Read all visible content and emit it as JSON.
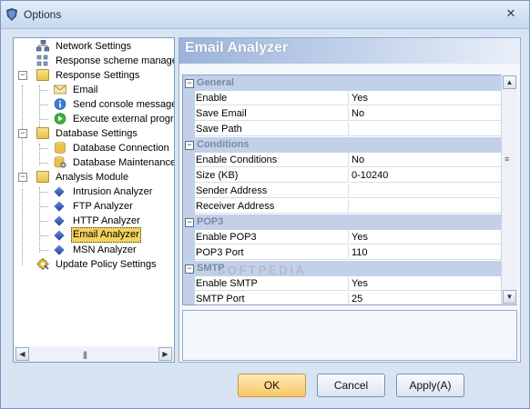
{
  "window": {
    "title": "Options",
    "close_glyph": "✕"
  },
  "tree": {
    "items": [
      {
        "label": "Network Settings",
        "icon": "network-icon"
      },
      {
        "label": "Response scheme management",
        "icon": "scheme-icon"
      },
      {
        "label": "Response Settings",
        "icon": "folder-icon"
      },
      {
        "label": "Email",
        "icon": "email-icon"
      },
      {
        "label": "Send console message",
        "icon": "info-icon"
      },
      {
        "label": "Execute external program",
        "icon": "play-icon"
      },
      {
        "label": "Database Settings",
        "icon": "folder-icon"
      },
      {
        "label": "Database Connection",
        "icon": "database-icon"
      },
      {
        "label": "Database Maintenance",
        "icon": "database-gear-icon"
      },
      {
        "label": "Analysis Module",
        "icon": "folder-icon"
      },
      {
        "label": "Intrusion Analyzer",
        "icon": "module-icon"
      },
      {
        "label": "FTP Analyzer",
        "icon": "module-icon"
      },
      {
        "label": "HTTP Analyzer",
        "icon": "module-icon"
      },
      {
        "label": "Email Analyzer",
        "icon": "module-icon",
        "selected": true
      },
      {
        "label": "MSN Analyzer",
        "icon": "module-icon"
      },
      {
        "label": "Update Policy Settings",
        "icon": "update-gear-icon"
      }
    ],
    "scroll_grip": "|||"
  },
  "panel": {
    "title": "Email Analyzer"
  },
  "grid": {
    "categories": [
      {
        "name": "General",
        "rows": [
          {
            "name": "Enable",
            "value": "Yes"
          },
          {
            "name": "Save Email",
            "value": "No"
          },
          {
            "name": "Save Path",
            "value": ""
          }
        ]
      },
      {
        "name": "Conditions",
        "rows": [
          {
            "name": "Enable Conditions",
            "value": "No"
          },
          {
            "name": "Size (KB)",
            "value": "0-10240"
          },
          {
            "name": "Sender Address",
            "value": ""
          },
          {
            "name": "Receiver Address",
            "value": ""
          }
        ]
      },
      {
        "name": "POP3",
        "rows": [
          {
            "name": "Enable POP3",
            "value": "Yes"
          },
          {
            "name": "POP3 Port",
            "value": "110"
          }
        ]
      },
      {
        "name": "SMTP",
        "rows": [
          {
            "name": "Enable SMTP",
            "value": "Yes"
          },
          {
            "name": "SMTP Port",
            "value": "25"
          }
        ]
      }
    ],
    "collapse_glyph": "−"
  },
  "buttons": {
    "ok": "OK",
    "cancel": "Cancel",
    "apply": "Apply(A)"
  },
  "watermark": "SOFTPEDIA",
  "colors": {
    "accent": "#f8c768",
    "selection": "#f3d35d",
    "header": "#9bb3d9"
  }
}
